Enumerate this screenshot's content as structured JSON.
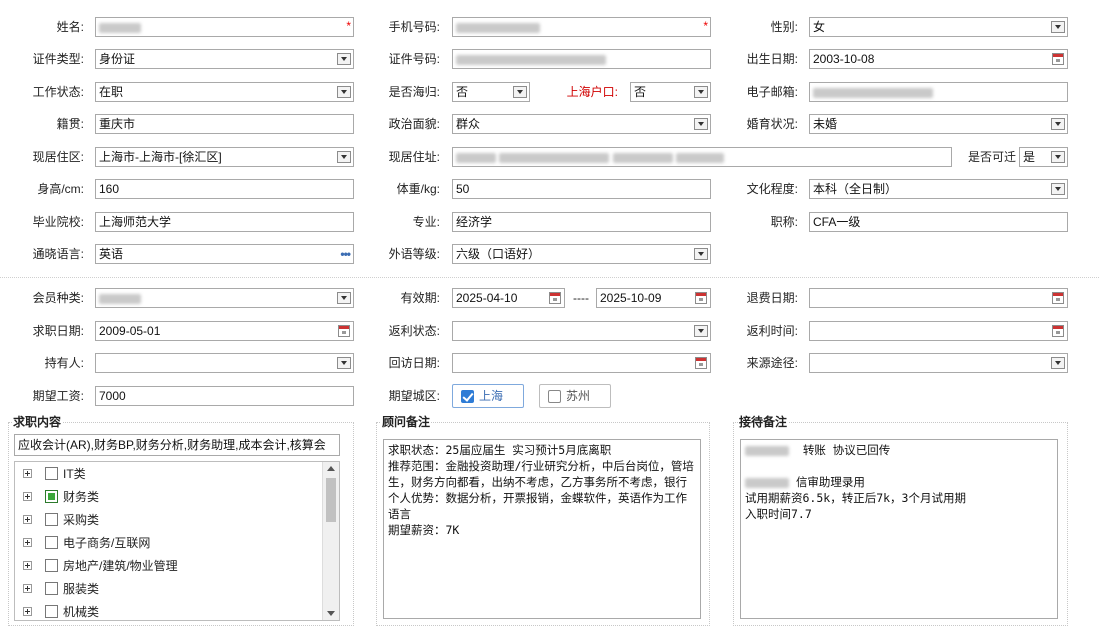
{
  "personal": {
    "name": {
      "label": "姓名:",
      "value": ""
    },
    "phone": {
      "label": "手机号码:",
      "value": ""
    },
    "gender": {
      "label": "性别:",
      "value": "女"
    },
    "id_type": {
      "label": "证件类型:",
      "value": "身份证"
    },
    "id_number": {
      "label": "证件号码:",
      "value": ""
    },
    "birth_date": {
      "label": "出生日期:",
      "value": "2003-10-08"
    },
    "work_status": {
      "label": "工作状态:",
      "value": "在职"
    },
    "is_returnee": {
      "label": "是否海归:",
      "value": "否"
    },
    "shanghai_hukou": {
      "label": "上海户口:",
      "value": "否"
    },
    "email": {
      "label": "电子邮箱:",
      "value": ""
    },
    "native_place": {
      "label": "籍贯:",
      "value": "重庆市"
    },
    "political_status": {
      "label": "政治面貌:",
      "value": "群众"
    },
    "marital_status": {
      "label": "婚育状况:",
      "value": "未婚"
    },
    "current_area": {
      "label": "现居住区:",
      "value": "上海市-上海市-[徐汇区]"
    },
    "current_address": {
      "label": "现居住址:",
      "value": ""
    },
    "relocatable": {
      "label": "是否可迁",
      "value": "是"
    },
    "height": {
      "label": "身高/cm:",
      "value": "160"
    },
    "weight": {
      "label": "体重/kg:",
      "value": "50"
    },
    "education": {
      "label": "文化程度:",
      "value": "本科（全日制）"
    },
    "school": {
      "label": "毕业院校:",
      "value": "上海师范大学"
    },
    "major": {
      "label": "专业:",
      "value": "经济学"
    },
    "title": {
      "label": "职称:",
      "value": "CFA一级"
    },
    "language": {
      "label": "通晓语言:",
      "value": "英语"
    },
    "language_level": {
      "label": "外语等级:",
      "value": "六级（口语好）"
    }
  },
  "membership": {
    "member_type": {
      "label": "会员种类:",
      "value": ""
    },
    "validity": {
      "label": "有效期:",
      "start": "2025-04-10",
      "sep": "----",
      "end": "2025-10-09"
    },
    "refund_date": {
      "label": "退费日期:",
      "value": ""
    },
    "job_date": {
      "label": "求职日期:",
      "value": "2009-05-01"
    },
    "rebate_status": {
      "label": "返利状态:",
      "value": ""
    },
    "rebate_time": {
      "label": "返利时间:",
      "value": ""
    },
    "holder": {
      "label": "持有人:",
      "value": ""
    },
    "visit_date": {
      "label": "回访日期:",
      "value": ""
    },
    "source": {
      "label": "来源途径:",
      "value": ""
    },
    "expected_salary": {
      "label": "期望工资:",
      "value": "7000"
    },
    "expected_city": {
      "label": "期望城区:",
      "options": [
        {
          "label": "上海",
          "checked": true
        },
        {
          "label": "苏州",
          "checked": false
        }
      ]
    }
  },
  "job_content": {
    "title": "求职内容",
    "summary": "应收会计(AR),财务BP,财务分析,财务助理,成本会计,核算会",
    "tree": [
      {
        "label": "IT类",
        "checked": false
      },
      {
        "label": "财务类",
        "checked": true
      },
      {
        "label": "采购类",
        "checked": false
      },
      {
        "label": "电子商务/互联网",
        "checked": false
      },
      {
        "label": "房地产/建筑/物业管理",
        "checked": false
      },
      {
        "label": "服装类",
        "checked": false
      },
      {
        "label": "机械类",
        "checked": false
      }
    ]
  },
  "consultant_notes": {
    "title": "顾问备注",
    "lines": [
      "求职状态：25届应届生 实习预计5月底离职",
      "推荐范围：金融投资助理/行业研究分析，中后台岗位，管培生，财务方向都看，出纳不考虑，乙方事务所不考虑，银行",
      "个人优势：数据分析，开票报销，金蝶软件，英语作为工作语言",
      "期望薪资：7K"
    ]
  },
  "reception_notes": {
    "title": "接待备注",
    "line1": "转账 协议已回传",
    "line2": "信审助理录用",
    "line3": "试用期薪资6.5k，转正后7k，3个月试用期",
    "line4": "入职时间7.7"
  }
}
